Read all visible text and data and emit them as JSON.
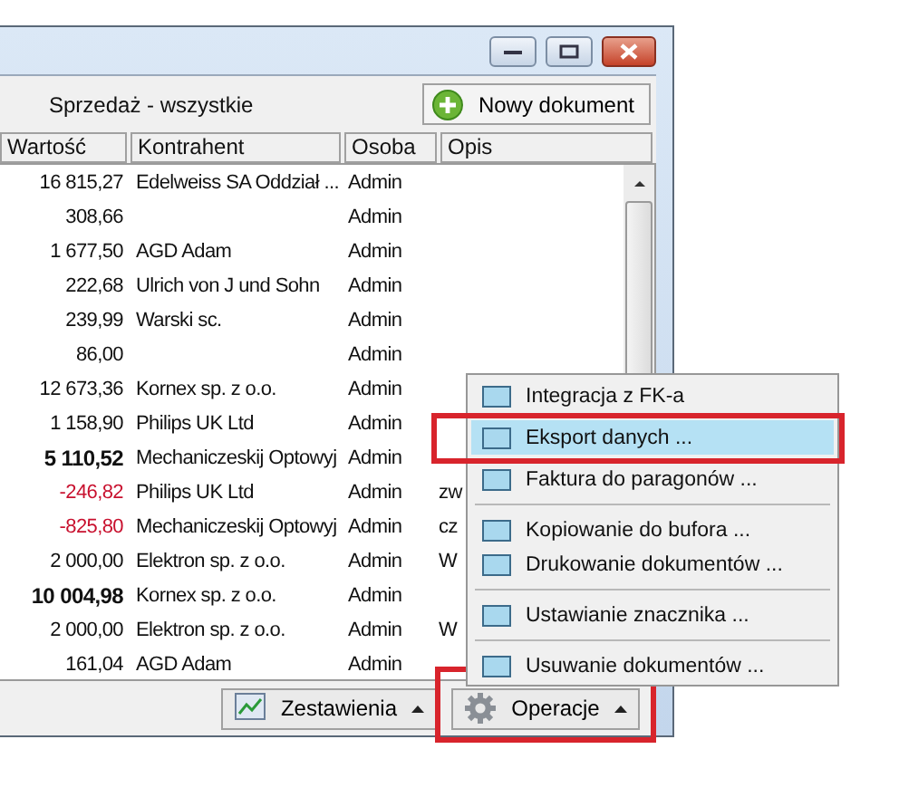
{
  "toolbar": {
    "view_title": "Sprzedaż - wszystkie",
    "new_button": "Nowy dokument"
  },
  "table": {
    "columns": [
      "Wartość",
      "Kontrahent",
      "Osoba",
      "Opis"
    ],
    "rows": [
      {
        "kind": "normal",
        "value": "16 815,27",
        "contractor": "Edelweiss SA Oddział ...",
        "person": "Admin"
      },
      {
        "kind": "normal",
        "value": "308,66",
        "person": "Admin"
      },
      {
        "kind": "normal",
        "value": "1 677,50",
        "contractor": "AGD Adam",
        "person": "Admin"
      },
      {
        "kind": "normal",
        "value": "222,68",
        "contractor": "Ulrich von J und Sohn",
        "person": "Admin"
      },
      {
        "kind": "normal",
        "value": "239,99",
        "contractor": "Warski sc.",
        "person": "Admin"
      },
      {
        "kind": "normal",
        "value": "86,00",
        "person": "Admin"
      },
      {
        "kind": "normal",
        "value": "12 673,36",
        "contractor": "Kornex sp. z o.o.",
        "person": "Admin"
      },
      {
        "kind": "normal",
        "value": "1 158,90",
        "contractor": "Philips UK Ltd",
        "person": "Admin"
      },
      {
        "kind": "bold",
        "value": "5 110,52",
        "contractor": "Mechaniczeskij Optowyj",
        "person": "Admin"
      },
      {
        "kind": "negative",
        "value": "-246,82",
        "contractor": "Philips UK Ltd",
        "person": "Admin",
        "description": "zw"
      },
      {
        "kind": "negative",
        "value": "-825,80",
        "contractor": "Mechaniczeskij Optowyj",
        "person": "Admin",
        "description": "cz"
      },
      {
        "kind": "normal",
        "value": "2 000,00",
        "contractor": "Elektron sp. z o.o.",
        "person": "Admin",
        "description": "W"
      },
      {
        "kind": "bold",
        "value": "10 004,98",
        "contractor": "Kornex sp. z o.o.",
        "person": "Admin"
      },
      {
        "kind": "normal",
        "value": "2 000,00",
        "contractor": "Elektron sp. z o.o.",
        "person": "Admin",
        "description": "W"
      },
      {
        "kind": "normal",
        "value": "161,04",
        "contractor": "AGD Adam",
        "person": "Admin"
      }
    ]
  },
  "footer": {
    "buttons": [
      {
        "kind": "chart",
        "label": "Zestawienia",
        "highlighted": false
      },
      {
        "kind": "gear",
        "label": "Operacje",
        "highlighted": true
      }
    ]
  },
  "menu": {
    "items": [
      {
        "kind": "item",
        "label": "Integracja z FK-a",
        "selected": false,
        "highlighted": false
      },
      {
        "kind": "item",
        "label": "Eksport danych ...",
        "selected": true,
        "highlighted": true
      },
      {
        "kind": "item",
        "label": "Faktura do paragonów ...",
        "selected": false,
        "highlighted": false
      },
      {
        "kind": "separator"
      },
      {
        "kind": "item",
        "label": "Kopiowanie do bufora ...",
        "selected": false,
        "highlighted": false
      },
      {
        "kind": "item",
        "label": "Drukowanie dokumentów ...",
        "selected": false,
        "highlighted": false
      },
      {
        "kind": "separator"
      },
      {
        "kind": "item",
        "label": "Ustawianie znacznika ...",
        "selected": false,
        "highlighted": false
      },
      {
        "kind": "separator"
      },
      {
        "kind": "item",
        "label": "Usuwanie dokumentów ...",
        "selected": false,
        "highlighted": false
      }
    ]
  }
}
